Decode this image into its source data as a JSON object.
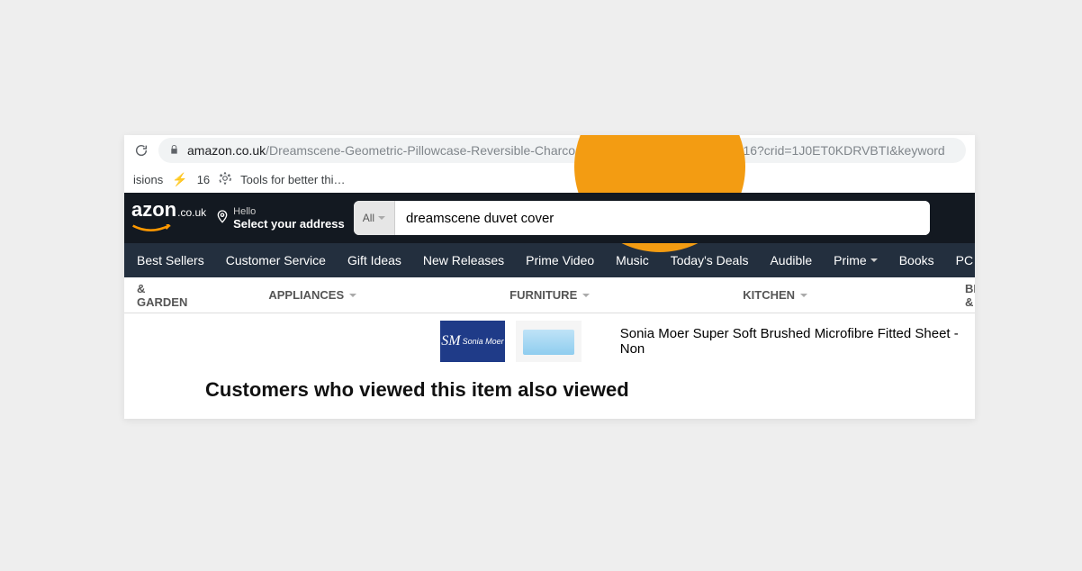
{
  "browser": {
    "url_domain": "amazon.co.uk",
    "url_path": "/Dreamscene-Geometric-Pillowcase-Reversible-Charcoal/dp/B082DL7SMX/ref=sr_1_16?crid=1J0ET0KDRVBTI&keyword",
    "bookmarks": {
      "ext_partial": "isions",
      "count": "16",
      "tool": "Tools for better thi…"
    }
  },
  "header": {
    "logo_text": "azon",
    "logo_tld": ".co.uk",
    "deliver_hello": "Hello",
    "deliver_select": "Select your address"
  },
  "search": {
    "category": "All",
    "value": "dreamscene duvet cover"
  },
  "nav": [
    "Best Sellers",
    "Customer Service",
    "Gift Ideas",
    "New Releases",
    "Prime Video",
    "Music",
    "Today's Deals",
    "Audible",
    "Prime",
    "Books",
    "PC &"
  ],
  "subnav": {
    "left_partial": "& GARDEN",
    "appliances": "APPLIANCES",
    "furniture": "FURNITURE",
    "kitchen": "KITCHEN",
    "bedding": "BEDDING & L"
  },
  "product": {
    "brand_logo_text": "Sonia Moer",
    "title": "Sonia Moer Super Soft Brushed Microfibre Fitted Sheet - Non"
  },
  "section_heading": "Customers who viewed this item also viewed"
}
